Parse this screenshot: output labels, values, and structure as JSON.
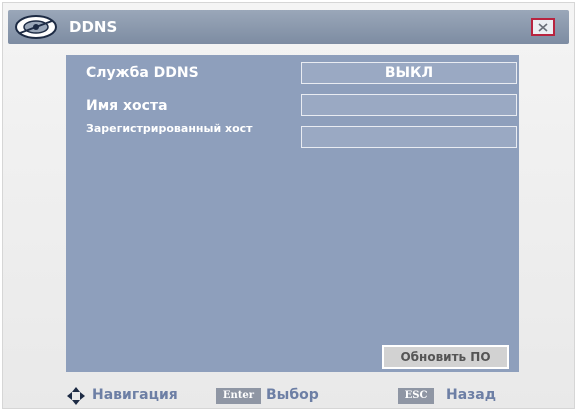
{
  "window": {
    "title": "DDNS",
    "logo_icon": "satellite-dish-icon",
    "close_icon": "close-icon"
  },
  "form": {
    "ddns_service": {
      "label": "Служба DDNS",
      "value": "ВЫКЛ"
    },
    "host_name": {
      "label": "Имя хоста",
      "value": ""
    },
    "registered_host": {
      "label": "Зарегистрированный хост",
      "value": ""
    }
  },
  "buttons": {
    "update_firmware": "Обновить ПО"
  },
  "footer": {
    "navigation_icon": "navigation-arrows-icon",
    "navigation": "Навигация",
    "enter_key": "Enter",
    "select": "Выбор",
    "esc_key": "ESC",
    "back": "Назад"
  },
  "colors": {
    "panel": "#8e9fbc",
    "titlebar": "#8a98ad",
    "close_border": "#b8243f",
    "footer_text": "#6d7fa5"
  }
}
